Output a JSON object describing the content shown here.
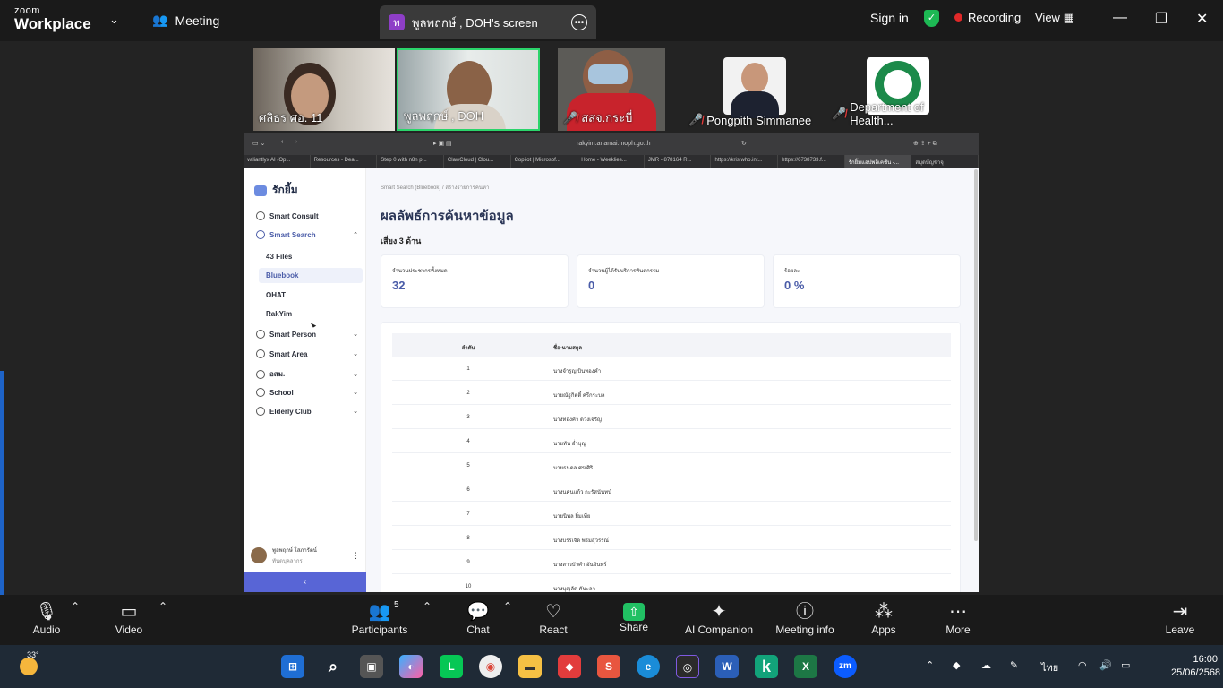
{
  "zoom": {
    "logo_line1": "zoom",
    "logo_line2": "Workplace",
    "meeting_label": "Meeting",
    "screen_share_title": "พูลพฤกษ์ , DOH's screen",
    "sign_in": "Sign in",
    "recording": "Recording",
    "view": "View"
  },
  "participants_strip": [
    {
      "name": "ศลิธร ศอ. 11",
      "muted": false
    },
    {
      "name": "พูลพฤกษ์ , DOH",
      "muted": false
    },
    {
      "name": "สสจ.กระบี่",
      "muted": true
    },
    {
      "name": "Pongpith Simmanee",
      "muted": true
    },
    {
      "name": "Department of Health...",
      "muted": true
    }
  ],
  "browser": {
    "url": "rakyim.anamai.moph.go.th",
    "tabs": [
      "valiantlyx AI (Op...",
      "Resources - Dea...",
      "Step 0 with n8n p...",
      "ClawCloud | Clou...",
      "Copilot | Microsof...",
      "Home - Weeklies...",
      "JMR - 878164 R...",
      "https://kris.who.int...",
      "https://6738733.f...",
      "รักยิ้มแอปพลิเคชัน -...",
      "สมุดบัญชาจุ"
    ]
  },
  "app": {
    "brand": "รักยิ้ม",
    "nav": {
      "smart_consult": "Smart Consult",
      "smart_search": "Smart Search",
      "sub": [
        "43 Files",
        "Bluebook",
        "OHAT",
        "RakYim"
      ],
      "smart_person": "Smart Person",
      "smart_area": "Smart Area",
      "osm": "อสม.",
      "school": "School",
      "elderly": "Elderly Club"
    },
    "user_name": "พูลพฤกษ์ โสภารัตน์",
    "user_role": "ทันตบุคลากร",
    "collapse_icon": "‹",
    "breadcrumb": "Smart Search (Bluebook)  /  สร้างรายการค้นหา",
    "page_title": "ผลลัพธ์การค้นหาข้อมูล",
    "subtitle": "เสี่ยง 3 ด้าน",
    "cards": [
      {
        "label": "จำนวนประชากรทั้งหมด",
        "value": "32"
      },
      {
        "label": "จำนวนผู้ได้รับบริการทันตกรรม",
        "value": "0"
      },
      {
        "label": "ร้อยละ",
        "value": "0 %"
      }
    ],
    "table": {
      "col_no": "ลำดับ",
      "col_name": "ชื่อ-นามสกุล",
      "rows": [
        {
          "no": "1",
          "name": "นางจำรูญ บินทองคำ"
        },
        {
          "no": "2",
          "name": "นายณัฐกิตติ์ ศรีกระบล"
        },
        {
          "no": "3",
          "name": "นางทองคำ ดวงเจริญ"
        },
        {
          "no": "4",
          "name": "นายทัน อ่ำบุญ"
        },
        {
          "no": "5",
          "name": "นายธนดล ศรเศิริ"
        },
        {
          "no": "6",
          "name": "นางนคนแก้ว กะรัสนันทน์"
        },
        {
          "no": "7",
          "name": "นายนิพล ยิ้มเทีย"
        },
        {
          "no": "8",
          "name": "นางบรรเจิด พรมสุวรรณ์"
        },
        {
          "no": "9",
          "name": "นางสาวบัวคำ อันอินทร์"
        },
        {
          "no": "10",
          "name": "นางบุญลัด คันะลา"
        }
      ]
    }
  },
  "toolbar": {
    "audio": "Audio",
    "video": "Video",
    "participants": "Participants",
    "participants_count": "5",
    "chat": "Chat",
    "react": "React",
    "share": "Share",
    "ai_companion": "AI Companion",
    "meeting_info": "Meeting info",
    "apps": "Apps",
    "more": "More",
    "leave": "Leave"
  },
  "taskbar": {
    "temperature": "33°",
    "language": "ไทย",
    "time": "16:00",
    "date": "25/06/2568"
  }
}
